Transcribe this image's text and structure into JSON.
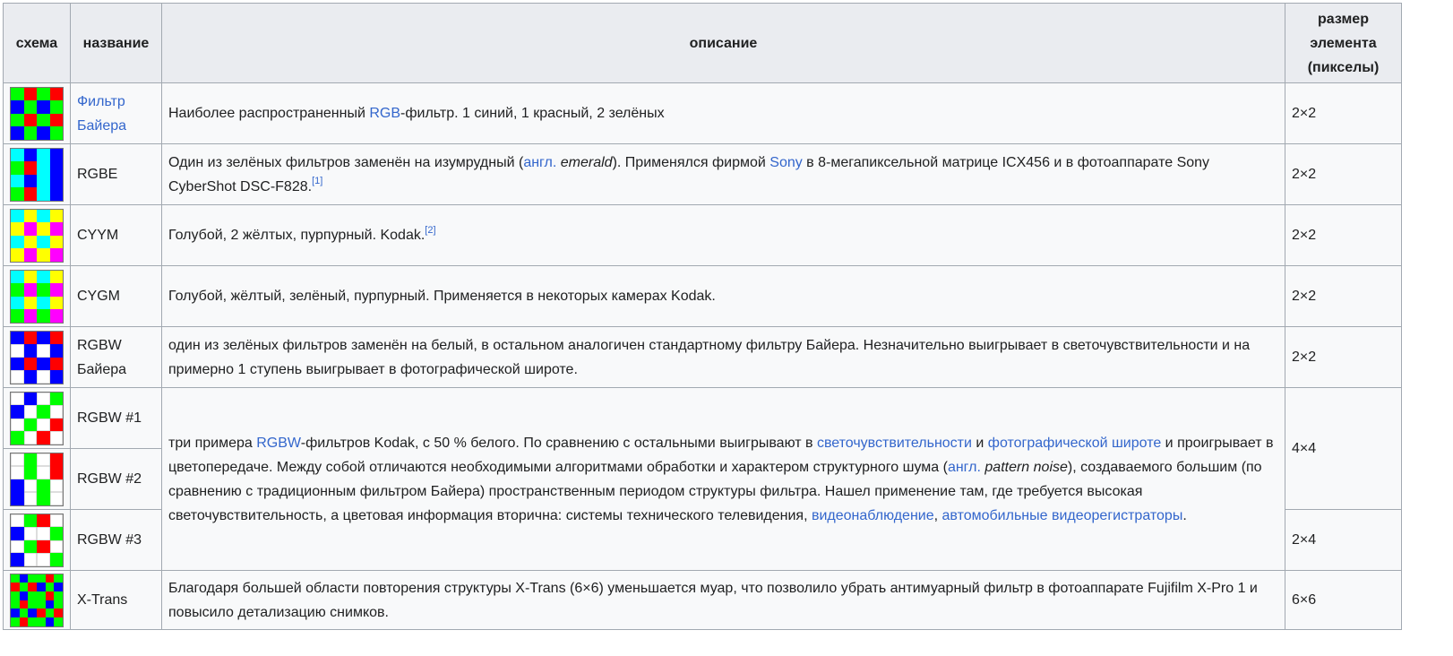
{
  "colors": {
    "R": "#ff0000",
    "G": "#00ff00",
    "B": "#0000ff",
    "C": "#00ffff",
    "Y": "#ffff00",
    "M": "#ff00ff",
    "W": "#ffffff",
    "E": "#00ffff",
    "link": "#3366cc"
  },
  "headers": {
    "scheme": "схема",
    "name": "название",
    "description": "описание",
    "size": "размер элемента (пикселы)"
  },
  "rows": [
    {
      "name": "Фильтр Байера",
      "name_is_link": true,
      "size": "2×2",
      "pattern": [
        "GRGR",
        "BGBG",
        "GRGR",
        "BGBG"
      ],
      "desc": [
        {
          "t": "Наиболее распространенный "
        },
        {
          "t": "RGB",
          "link": true
        },
        {
          "t": "-фильтр. 1 синий, 1 красный, 2 зелёных"
        }
      ]
    },
    {
      "name": "RGBE",
      "size": "2×2",
      "pattern": [
        "EBEB",
        "GREB",
        "EBEB",
        "GREB"
      ],
      "desc": [
        {
          "t": "Один из зелёных фильтров заменён на изумрудный ("
        },
        {
          "t": "англ.",
          "link": true
        },
        {
          "t": " "
        },
        {
          "t": "emerald",
          "italic": true
        },
        {
          "t": "). Применялся фирмой "
        },
        {
          "t": "Sony",
          "link": true
        },
        {
          "t": " в 8-мегапиксельной матрице ICX456 и в фотоаппарате Sony CyberShot DSC-F828."
        },
        {
          "t": "[1]",
          "sup": true
        }
      ]
    },
    {
      "name": "CYYM",
      "size": "2×2",
      "pattern": [
        "CYCY",
        "YMYM",
        "CYCY",
        "YMYM"
      ],
      "desc": [
        {
          "t": "Голубой, 2 жёлтых, пурпурный. Kodak."
        },
        {
          "t": "[2]",
          "sup": true
        }
      ]
    },
    {
      "name": "CYGM",
      "size": "2×2",
      "pattern": [
        "CYCY",
        "GMGM",
        "CYCY",
        "GMGM"
      ],
      "desc": [
        {
          "t": "Голубой, жёлтый, зелёный, пурпурный. Применяется в некоторых камерах Kodak."
        }
      ]
    },
    {
      "name": "RGBW Байера",
      "size": "2×2",
      "pattern": [
        "BRBR",
        "WBWB",
        "BRBR",
        "WBWB"
      ],
      "desc": [
        {
          "t": "один из зелёных фильтров заменён на белый, в остальном аналогичен стандартному фильтру Байера. Незначительно выигрывает в светочувствительности и на примерно 1 ступень выигрывает в фотографической широте."
        }
      ]
    },
    {
      "name": "RGBW #1",
      "pattern": [
        "WBWG",
        "BWGW",
        "WGWR",
        "GWRW"
      ]
    },
    {
      "name": "RGBW #2",
      "pattern": [
        "WGWR",
        "WGWR",
        "BWGW",
        "BWGW"
      ]
    },
    {
      "name": "RGBW #3",
      "size": "2×4",
      "pattern": [
        "WGRW",
        "BWWG",
        "WGRW",
        "BWWG"
      ]
    },
    {
      "name": "X-Trans",
      "size": "6×6",
      "pattern": [
        "GBGGRG",
        "RGRBGB",
        "GBGGRG",
        "GRGGBG",
        "BGBRGR",
        "GRGGBG"
      ],
      "desc": [
        {
          "t": "Благодаря большей области повторения структуры X-Trans (6×6) уменьшается муар, что позволило убрать антимуарный фильтр в фотоаппарате Fujifilm X-Pro 1 и повысило детализацию снимков."
        }
      ]
    }
  ],
  "rgbw_group": {
    "size": "4×4",
    "desc": [
      {
        "t": "три примера "
      },
      {
        "t": "RGBW",
        "link": true
      },
      {
        "t": "-фильтров Kodak, с 50 % белого. По сравнению с остальными выигрывают в "
      },
      {
        "t": "светочувствительности",
        "link": true
      },
      {
        "t": " и "
      },
      {
        "t": "фотографической широте",
        "link": true
      },
      {
        "t": " и проигрывает в цветопередаче. Между собой отличаются необходимыми алгоритмами обработки и характером структурного шума ("
      },
      {
        "t": "англ.",
        "link": true
      },
      {
        "t": " "
      },
      {
        "t": "pattern noise",
        "italic": true
      },
      {
        "t": "), создаваемого большим (по сравнению с традиционным фильтром Байера) пространственным периодом структуры фильтра. Нашел применение там, где требуется высокая светочувствительность, а цветовая информация вторична: системы технического телевидения, "
      },
      {
        "t": "видеонаблюдение",
        "link": true
      },
      {
        "t": ", "
      },
      {
        "t": "автомобильные видеорегистраторы",
        "link": true
      },
      {
        "t": "."
      }
    ]
  }
}
